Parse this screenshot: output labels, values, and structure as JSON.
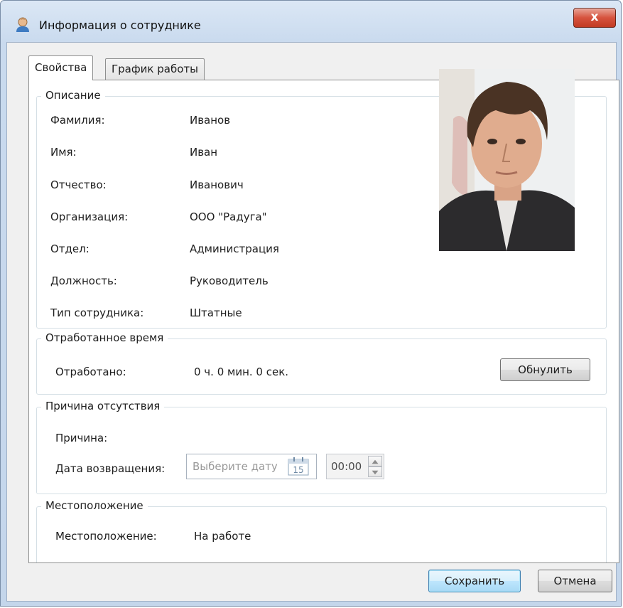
{
  "window": {
    "title": "Информация о сотруднике",
    "close_label": "x"
  },
  "tabs": [
    {
      "label": "Свойства",
      "active": true
    },
    {
      "label": "График работы",
      "active": false
    }
  ],
  "description": {
    "title": "Описание",
    "fields": [
      {
        "label": "Фамилия:",
        "value": "Иванов"
      },
      {
        "label": "Имя:",
        "value": "Иван"
      },
      {
        "label": "Отчество:",
        "value": "Иванович"
      },
      {
        "label": "Организация:",
        "value": "ООО \"Радуга\""
      },
      {
        "label": "Отдел:",
        "value": "Администрация"
      },
      {
        "label": "Должность:",
        "value": "Руководитель"
      },
      {
        "label": "Тип сотрудника:",
        "value": "Штатные"
      }
    ]
  },
  "worked_time": {
    "title": "Отработанное время",
    "label": "Отработано:",
    "value": "0 ч. 0 мин. 0 сек.",
    "reset_button": "Обнулить"
  },
  "absence": {
    "title": "Причина отсутствия",
    "reason_label": "Причина:",
    "return_date_label": "Дата возвращения:",
    "date_placeholder": "Выберите дату",
    "calendar_day": "15",
    "time_value": "00:00"
  },
  "location": {
    "title": "Местоположение",
    "label": "Местоположение:",
    "value": "На работе"
  },
  "footer": {
    "save_button": "Сохранить",
    "cancel_button": "Отмена"
  },
  "colors": {
    "title_bar": "#c9daee",
    "close_button": "#c23a23",
    "default_button_border": "#3c7fb1"
  }
}
